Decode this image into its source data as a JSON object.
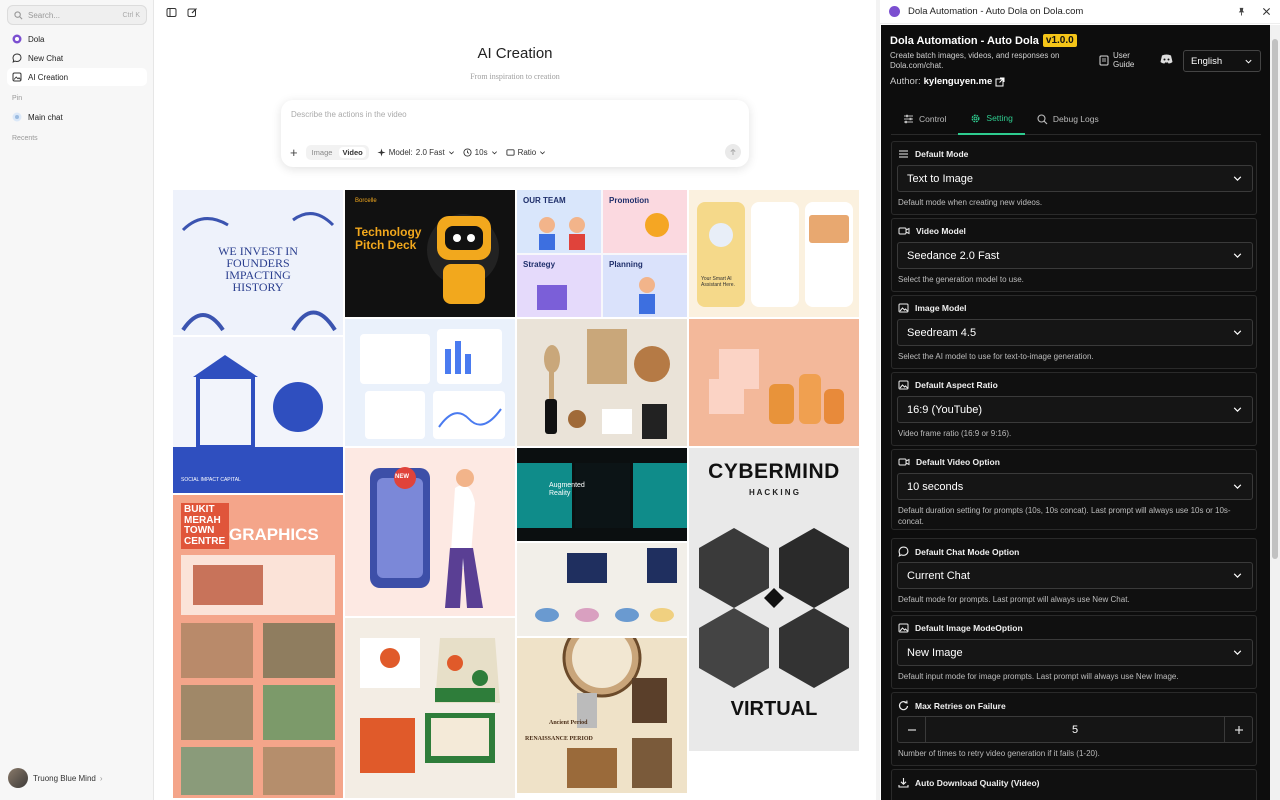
{
  "sidebar": {
    "search_placeholder": "Search...",
    "search_shortcut": "Ctrl K",
    "items": [
      {
        "label": "Dola"
      },
      {
        "label": "New Chat"
      },
      {
        "label": "AI Creation"
      }
    ],
    "pin_label": "Pin",
    "pinned": [
      {
        "label": "Main chat"
      }
    ],
    "recents_label": "Recents",
    "user_name": "Truong Blue Mind"
  },
  "main": {
    "title": "AI Creation",
    "subtitle": "From inspiration to creation",
    "composer": {
      "placeholder": "Describe the actions in the video",
      "mode_image": "Image",
      "mode_video": "Video",
      "model_label": "Model:",
      "model_value": "2.0 Fast",
      "duration": "10s",
      "ratio": "Ratio"
    },
    "gallery": [
      {
        "text": "WE INVEST IN FOUNDERS IMPACTING HISTORY"
      },
      {
        "text": "SOCIAL IMPACT CAPITAL"
      },
      {
        "text": "BUKIT MERAH TOWN CENTRE"
      },
      {
        "text": "GRAPHICS"
      },
      {
        "text": "Technology Pitch Deck"
      },
      {
        "text": "Borcelle"
      },
      {
        "text": "NEW"
      },
      {
        "text": "OUR TEAM"
      },
      {
        "text": "Promotion"
      },
      {
        "text": "Strategy"
      },
      {
        "text": "Planning"
      },
      {
        "text": "Augmented Reality"
      },
      {
        "text": "Ancient Period"
      },
      {
        "text": "RENAISSANCE PERIOD"
      },
      {
        "text": "Your Smart AI Assistant Here."
      },
      {
        "text": "CYBERMIND"
      },
      {
        "text": "H A C K I N G"
      },
      {
        "text": "VIRTUAL"
      }
    ]
  },
  "panel": {
    "window_title": "Dola Automation - Auto Dola on Dola.com",
    "app_title": "Dola Automation - Auto Dola",
    "version": "v1.0.0",
    "description": "Create batch images, videos, and responses on Dola.com/chat.",
    "author_label": "Author:",
    "author_name": "kylenguyen.me",
    "user_guide": "User Guide",
    "language": "English",
    "tabs": [
      {
        "label": "Control"
      },
      {
        "label": "Setting"
      },
      {
        "label": "Debug Logs"
      }
    ],
    "settings": [
      {
        "label": "Default Mode",
        "value": "Text to Image",
        "help": "Default mode when creating new videos."
      },
      {
        "label": "Video Model",
        "value": "Seedance 2.0 Fast",
        "help": "Select the generation model to use."
      },
      {
        "label": "Image Model",
        "value": "Seedream 4.5",
        "help": "Select the AI model to use for text-to-image generation."
      },
      {
        "label": "Default Aspect Ratio",
        "value": "16:9 (YouTube)",
        "help": "Video frame ratio (16:9 or 9:16)."
      },
      {
        "label": "Default Video Option",
        "value": "10 seconds",
        "help": "Default duration setting for prompts (10s, 10s concat). Last prompt will always use 10s or 10s-concat."
      },
      {
        "label": "Default Chat Mode Option",
        "value": "Current Chat",
        "help": "Default mode for prompts. Last prompt will always use New Chat."
      },
      {
        "label": "Default Image ModeOption",
        "value": "New Image",
        "help": "Default input mode for image prompts. Last prompt will always use New Image."
      },
      {
        "label": "Max Retries on Failure",
        "value": "5",
        "help": "Number of times to retry video generation if it fails (1-20)."
      },
      {
        "label": "Auto Download Quality (Video)"
      }
    ],
    "accent": "#2ecc8f",
    "version_color": "#f5c518"
  }
}
